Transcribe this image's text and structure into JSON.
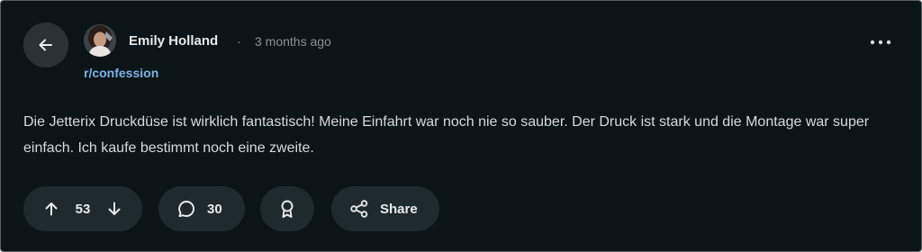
{
  "post": {
    "author": "Emily Holland",
    "separator": "·",
    "timestamp": "3 months ago",
    "subreddit": "r/confession",
    "body": "Die Jetterix Druckdüse ist wirklich fantastisch! Meine Einfahrt war noch nie so sauber. Der Druck ist stark und die Montage war super einfach. Ich kaufe bestimmt noch eine zweite."
  },
  "actions": {
    "score": "53",
    "comments": "30",
    "share_label": "Share"
  },
  "icons": {
    "back": "arrow-left-icon",
    "more": "more-horizontal-icon",
    "upvote": "arrow-up-icon",
    "downvote": "arrow-down-icon",
    "comment": "comment-bubble-icon",
    "award": "award-ribbon-icon",
    "share": "share-nodes-icon"
  },
  "colors": {
    "background": "#0b1416",
    "button_bg": "#1f2a2e",
    "link": "#7fb2e6",
    "text": "#d8dbdd",
    "muted": "#8b9396"
  }
}
